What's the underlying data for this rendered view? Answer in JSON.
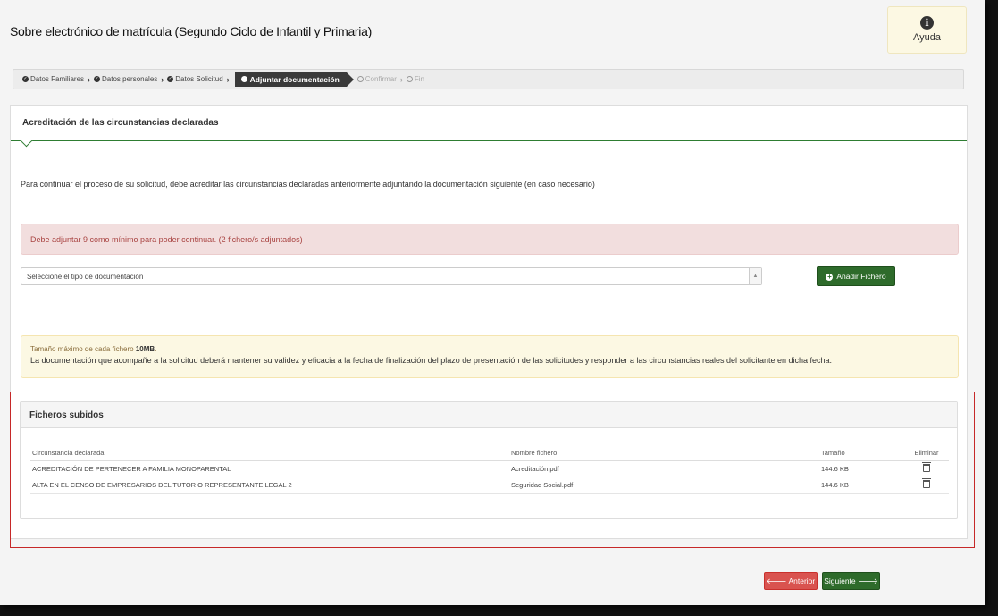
{
  "page": {
    "title": "Sobre electrónico de matrícula (Segundo Ciclo de Infantil y Primaria)"
  },
  "help": {
    "icon": "info-icon",
    "label": "Ayuda"
  },
  "breadcrumb": {
    "steps": [
      {
        "label": "Datos Familiares",
        "state": "done"
      },
      {
        "label": "Datos personales",
        "state": "done"
      },
      {
        "label": "Datos Solicitud",
        "state": "done"
      },
      {
        "label": "Adjuntar documentación",
        "state": "active"
      },
      {
        "label": "Confirmar",
        "state": "pending"
      },
      {
        "label": "Fin",
        "state": "pending"
      }
    ]
  },
  "panel": {
    "title": "Acreditación de las circunstancias declaradas",
    "intro": "Para continuar el proceso de su solicitud, debe acreditar las circunstancias declaradas anteriormente adjuntando la documentación siguiente (en caso necesario)",
    "alert_danger": "Debe adjuntar 9 como mínimo para poder continuar. (2 fichero/s adjuntados)",
    "select_placeholder": "Seleccione el tipo de documentación",
    "add_button": "Añadir Fichero",
    "warning_line1_prefix": "Tamaño máximo de cada fichero ",
    "warning_line1_bold": "10MB",
    "warning_line1_suffix": ".",
    "warning_line2": "La documentación que acompañe a la solicitud deberá mantener su validez y eficacia a la fecha de finalización del plazo de presentación de las solicitudes y responder a las circunstancias reales del solicitante en dicha fecha."
  },
  "files": {
    "title": "Ficheros subidos",
    "columns": [
      "Circunstancia declarada",
      "Nombre fichero",
      "Tamaño",
      "Eliminar"
    ],
    "rows": [
      {
        "circumstance": "ACREDITACIÓN DE PERTENECER A FAMILIA MONOPARENTAL",
        "file": "Acreditación.pdf",
        "size": "144.6 KB"
      },
      {
        "circumstance": "ALTA EN EL CENSO DE EMPRESARIOS DEL TUTOR O REPRESENTANTE LEGAL 2",
        "file": "Seguridad Social.pdf",
        "size": "144.6 KB"
      }
    ]
  },
  "footer": {
    "prev": "Anterior",
    "next": "Siguiente",
    "prev_color": "#d9534f",
    "next_color": "#2e6b2b"
  }
}
